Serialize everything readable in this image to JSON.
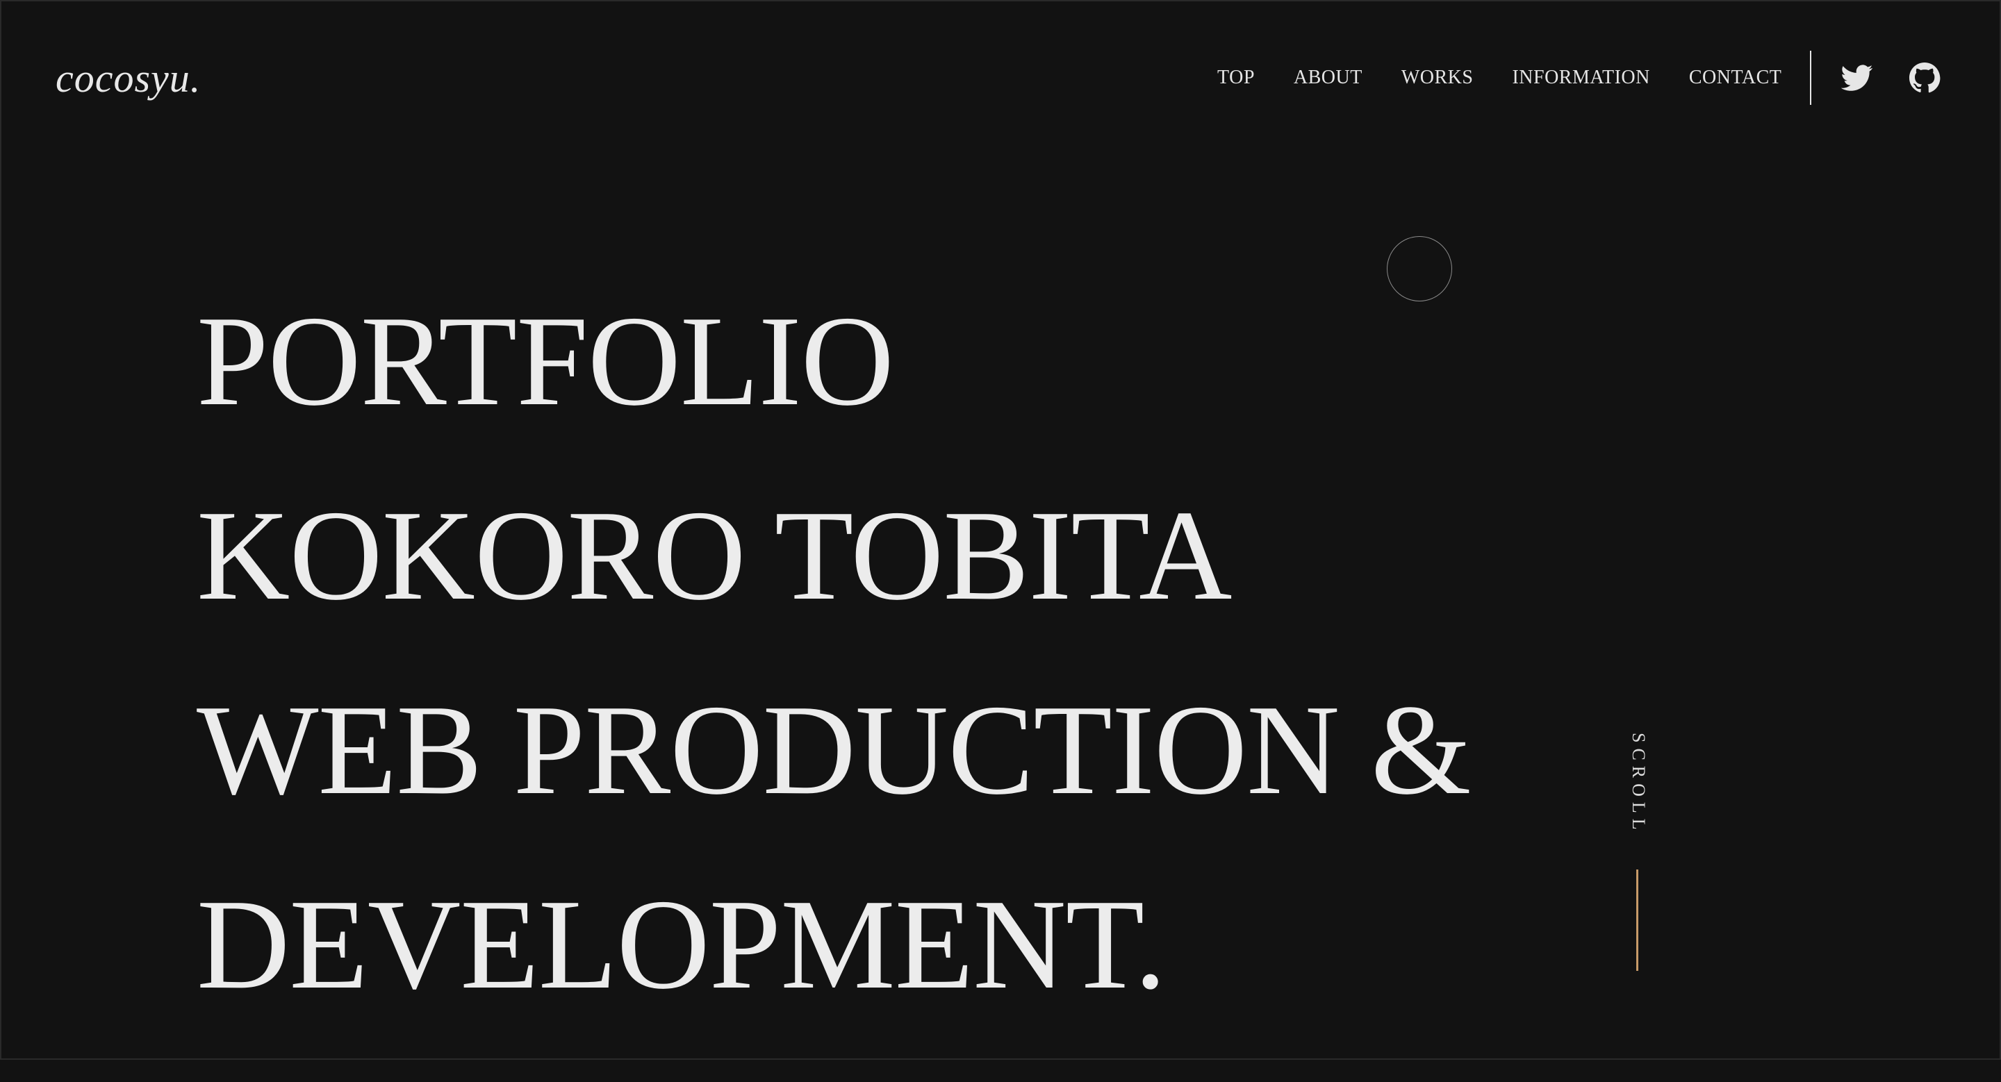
{
  "header": {
    "logo": "cocosyu.",
    "nav": [
      {
        "label": "TOP"
      },
      {
        "label": "ABOUT"
      },
      {
        "label": "WORKS"
      },
      {
        "label": "INFORMATION"
      },
      {
        "label": "CONTACT"
      }
    ],
    "social": [
      {
        "icon": "twitter-icon"
      },
      {
        "icon": "github-icon"
      }
    ]
  },
  "hero": {
    "lines": [
      "PORTFOLIO",
      "KOKORO TOBITA",
      "WEB PRODUCTION &",
      "DEVELOPMENT."
    ]
  },
  "scroll": {
    "label": "SCROLL"
  },
  "colors": {
    "background": "#121212",
    "text": "#ececec",
    "accent": "#c79a68"
  }
}
